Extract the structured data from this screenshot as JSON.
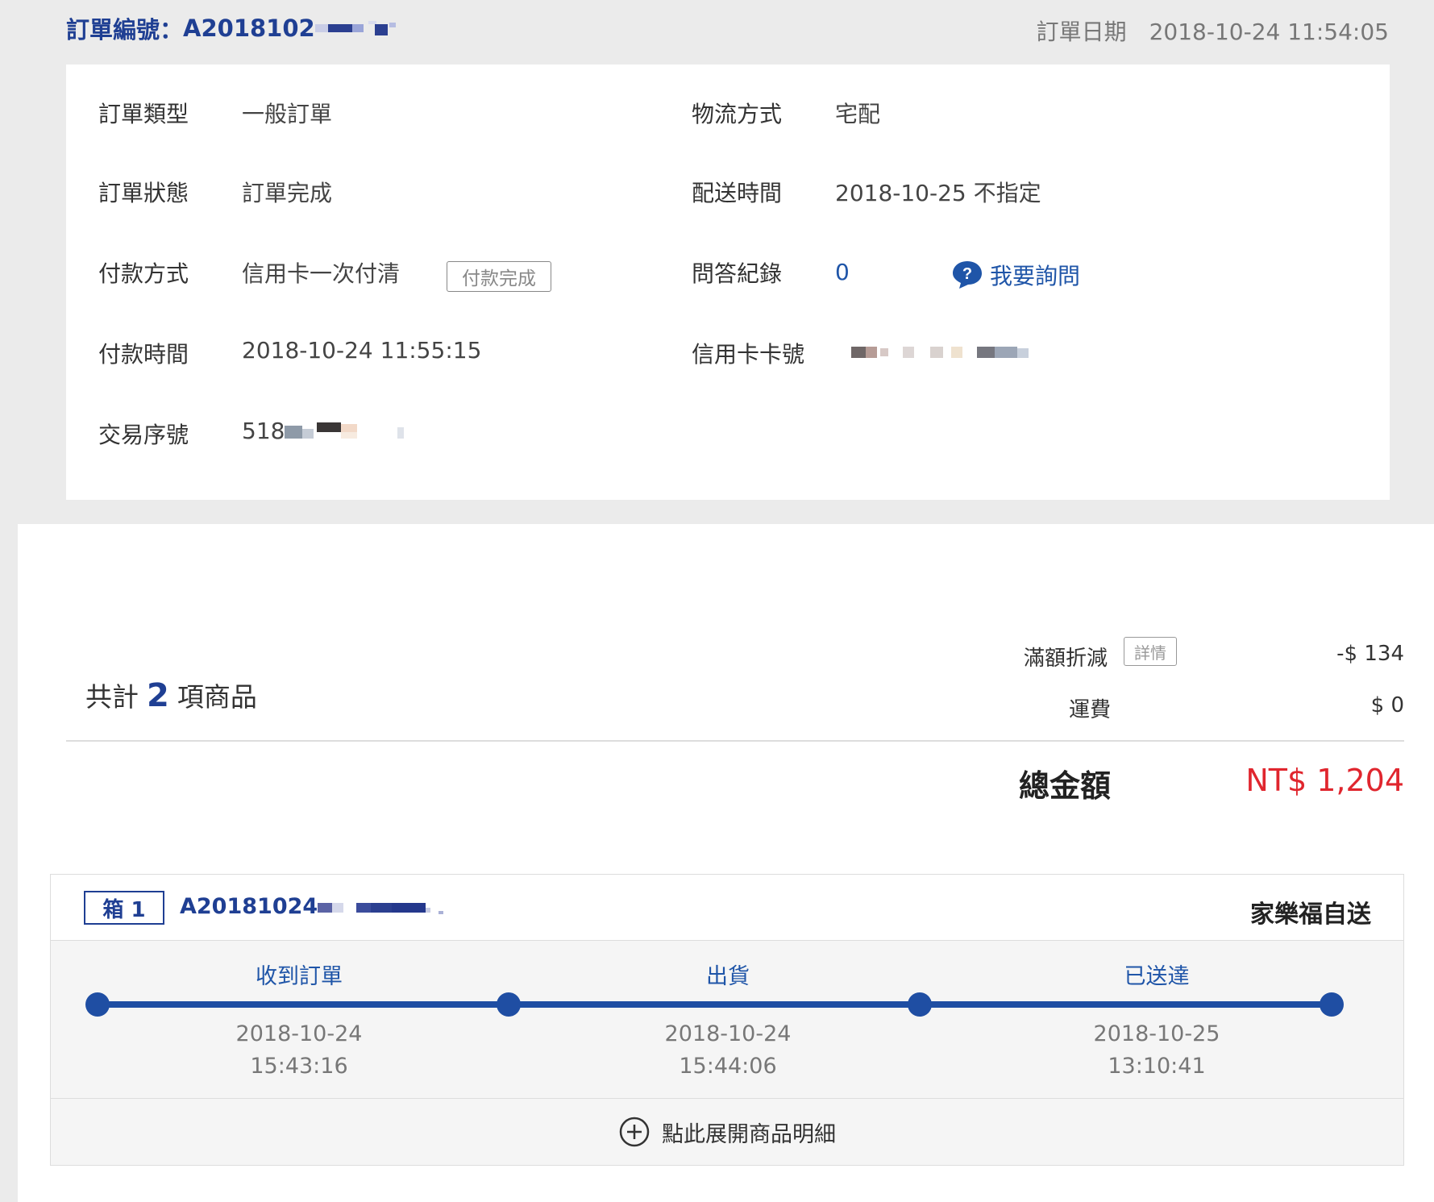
{
  "order": {
    "number_label": "訂單編號：",
    "number_visible": "A2018102",
    "date_label": "訂單日期",
    "date_value": "2018-10-24 11:54:05"
  },
  "details": {
    "order_type_label": "訂單類型",
    "order_type_value": "一般訂單",
    "order_status_label": "訂單狀態",
    "order_status_value": "訂單完成",
    "payment_method_label": "付款方式",
    "payment_method_value": "信用卡一次付清",
    "payment_status_tag": "付款完成",
    "payment_time_label": "付款時間",
    "payment_time_value": "2018-10-24 11:55:15",
    "transaction_no_label": "交易序號",
    "transaction_no_visible": "518",
    "logistics_label": "物流方式",
    "logistics_value": "宅配",
    "delivery_time_label": "配送時間",
    "delivery_time_value": "2018-10-25 不指定",
    "qa_label": "問答紀錄",
    "qa_count": "0",
    "ask_link": "我要詢問",
    "card_no_label": "信用卡卡號"
  },
  "summary": {
    "count_prefix": "共計",
    "count": "2",
    "count_suffix": "項商品",
    "discount_label": "滿額折減",
    "discount_detail_tag": "詳情",
    "discount_value": "-$ 134",
    "shipping_label": "運費",
    "shipping_value": "$ 0",
    "total_label": "總金額",
    "total_value": "NT$ 1,204"
  },
  "shipment": {
    "box_tag": "箱 1",
    "box_no_visible": "A20181024",
    "carrier": "家樂福自送",
    "steps": [
      {
        "label": "收到訂單",
        "date": "2018-10-24",
        "time": "15:43:16"
      },
      {
        "label": "出貨",
        "date": "2018-10-24",
        "time": "15:44:06"
      },
      {
        "label": "已送達",
        "date": "2018-10-25",
        "time": "13:10:41"
      }
    ],
    "expand_label": "點此展開商品明細"
  },
  "colors": {
    "brand_blue": "#1f3f93",
    "link_blue": "#1f55a8",
    "total_red": "#e0262e",
    "panel_gray": "#ebebeb"
  }
}
